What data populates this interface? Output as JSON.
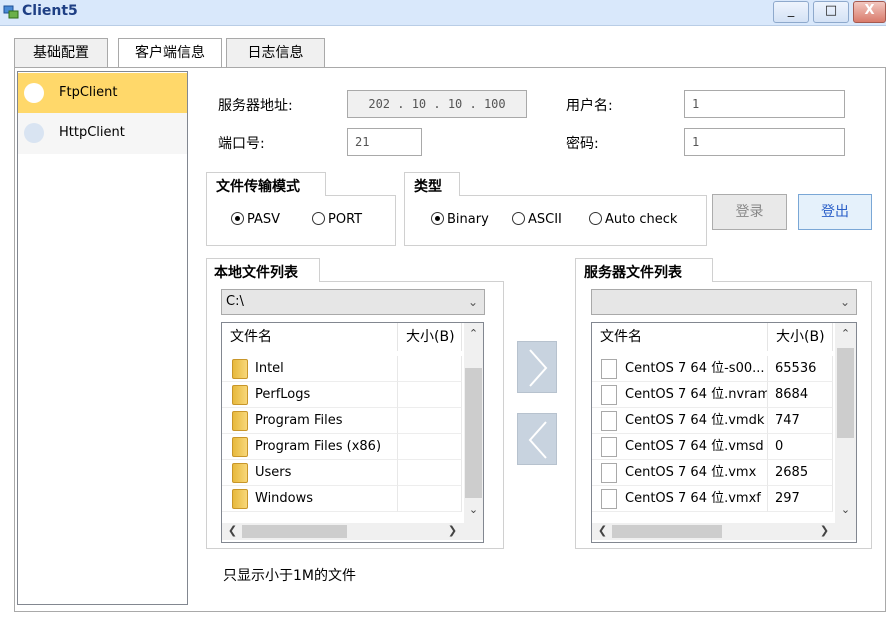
{
  "window": {
    "title": "Client5",
    "min_label": "_",
    "max_label": "□",
    "close_label": "X"
  },
  "tabs": [
    {
      "label": "基础配置",
      "active": false
    },
    {
      "label": "客户端信息",
      "active": true
    },
    {
      "label": "日志信息",
      "active": false
    }
  ],
  "clients": [
    {
      "label": "FtpClient",
      "selected": true
    },
    {
      "label": "HttpClient",
      "selected": false
    }
  ],
  "server": {
    "addr_label": "服务器地址:",
    "ip": "202 . 10 . 10 . 100",
    "port_label": "端口号:",
    "port": "21",
    "user_label": "用户名:",
    "user": "1",
    "pass_label": "密码:",
    "pass": "1"
  },
  "mode": {
    "title": "文件传输模式",
    "options": [
      "PASV",
      "PORT"
    ],
    "selected": "PASV"
  },
  "type": {
    "title": "类型",
    "options": [
      "Binary",
      "ASCII",
      "Auto check"
    ],
    "selected": "Binary"
  },
  "buttons": {
    "login": "登录",
    "logout": "登出"
  },
  "local": {
    "title": "本地文件列表",
    "path": "C:\\",
    "col_name": "文件名",
    "col_size": "大小(B)",
    "items": [
      "Intel",
      "PerfLogs",
      "Program Files",
      "Program Files (x86)",
      "Users",
      "Windows"
    ]
  },
  "remote": {
    "title": "服务器文件列表",
    "path": "",
    "col_name": "文件名",
    "col_size": "大小(B)",
    "items": [
      {
        "name": "CentOS 7 64 位-s00...",
        "size": "65536"
      },
      {
        "name": "CentOS 7 64 位.nvram",
        "size": "8684"
      },
      {
        "name": "CentOS 7 64 位.vmdk",
        "size": "747"
      },
      {
        "name": "CentOS 7 64 位.vmsd",
        "size": "0"
      },
      {
        "name": "CentOS 7 64 位.vmx",
        "size": "2685"
      },
      {
        "name": "CentOS 7 64 位.vmxf",
        "size": "297"
      }
    ]
  },
  "note": "只显示小于1M的文件"
}
